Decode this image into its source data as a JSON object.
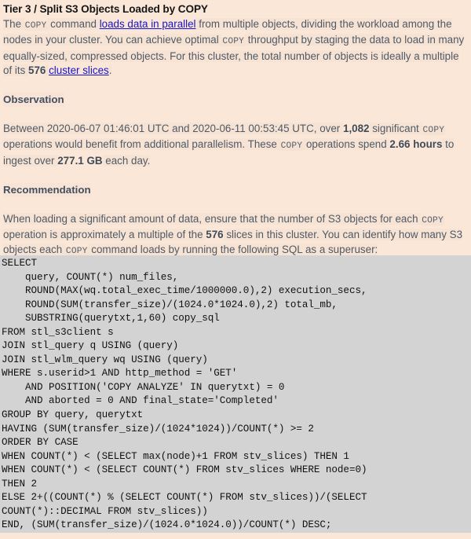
{
  "document": {
    "title": "Tier 3 / Split S3 Objects Loaded by COPY",
    "intro": {
      "t1": "The ",
      "code1": "COPY",
      "t2": " command ",
      "link1": "loads data in parallel",
      "t3": " from multiple objects, dividing the workload among the nodes in your cluster. You can achieve optimal ",
      "code2": "COPY",
      "t4": " throughput by staging the data to load in many equally-sized, compressed objects. For this cluster, the total number of objects is ideally a multiple of its ",
      "slices": "576",
      "t5": " ",
      "link2": "cluster slices",
      "t6": "."
    },
    "observation": {
      "heading": "Observation",
      "t1": "Between 2020-06-07 01:46:01 UTC and 2020-06-11 00:53:45 UTC, over ",
      "count": "1,082",
      "t2": " significant ",
      "code1": "COPY",
      "t3": " operations would benefit from additional parallelism. These ",
      "code2": "COPY",
      "t4": " operations spend ",
      "hours": "2.66 hours",
      "t5": " to ingest over ",
      "volume": "277.1 GB",
      "t6": " each day.",
      "start_time": "2020-06-07 01:46:01 UTC",
      "end_time": "2020-06-11 00:53:45 UTC"
    },
    "recommendation": {
      "heading": "Recommendation",
      "t1": "When loading a significant amount of data, ensure that the number of S3 objects for each ",
      "code1": "COPY",
      "t2": " operation is approximately a multiple of the ",
      "slices": "576",
      "t3": " slices in this cluster. You can identify how many S3 objects each ",
      "code2": "COPY",
      "t4": " command loads by running the following SQL as a superuser:"
    },
    "sql": {
      "lines": [
        "SELECT",
        "    query, COUNT(*) num_files,",
        "    ROUND(MAX(wq.total_exec_time/1000000.0),2) execution_secs,",
        "    ROUND(SUM(transfer_size)/(1024.0*1024.0),2) total_mb,",
        "    SUBSTRING(querytxt,1,60) copy_sql",
        "FROM stl_s3client s",
        "JOIN stl_query q USING (query)",
        "JOIN stl_wlm_query wq USING (query)",
        "WHERE s.userid>1 AND http_method = 'GET'",
        "    AND POSITION('COPY ANALYZE' IN querytxt) = 0",
        "    AND aborted = 0 AND final_state='Completed'",
        "GROUP BY query, querytxt",
        "HAVING (SUM(transfer_size)/(1024*1024))/COUNT(*) >= 2",
        "ORDER BY CASE",
        "WHEN COUNT(*) < (SELECT max(node)+1 FROM stv_slices) THEN 1",
        "WHEN COUNT(*) < (SELECT COUNT(*) FROM stv_slices WHERE node=0)",
        "THEN 2",
        "ELSE 2+((COUNT(*) % (SELECT COUNT(*) FROM stv_slices))/(SELECT",
        "COUNT(*)::DECIMAL FROM stv_slices))",
        "END, (SUM(transfer_size)/(1024.0*1024.0))/COUNT(*) DESC;"
      ]
    }
  },
  "colors": {
    "page_background": "#fbe7d7",
    "body_text": "#4e5a66",
    "title_text": "#161616",
    "link": "#1713c9",
    "code_block_background": "#d3d3d3",
    "code_block_text": "#111111"
  }
}
